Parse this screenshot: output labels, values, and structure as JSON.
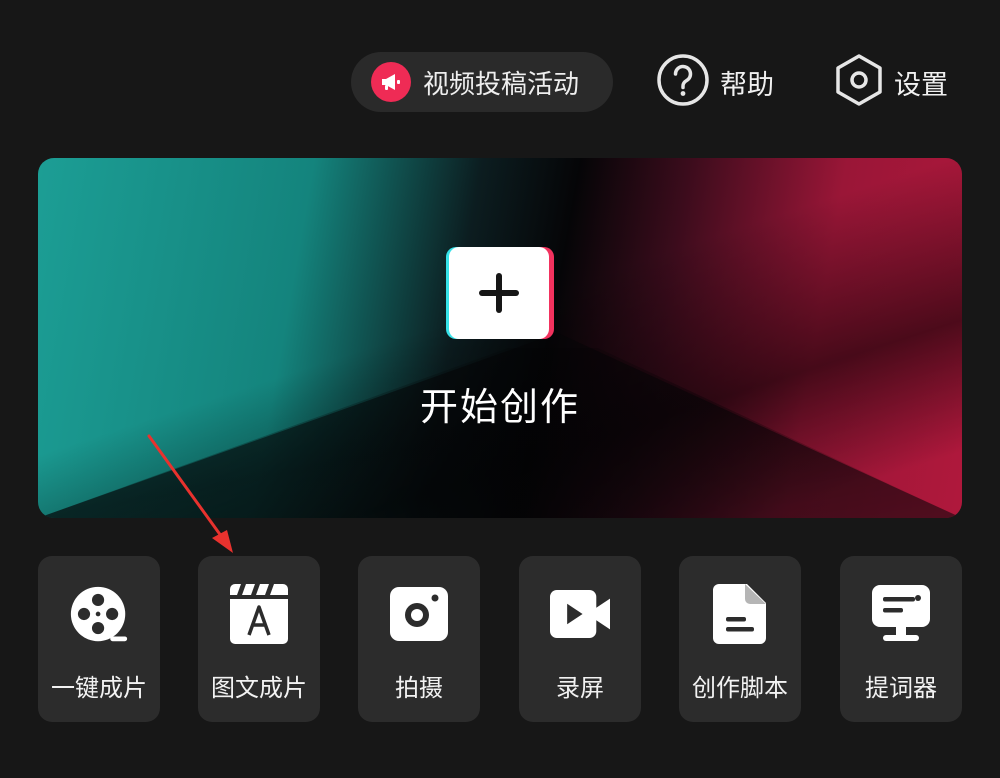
{
  "top_bar": {
    "campaign_label": "视频投稿活动",
    "help_label": "帮助",
    "settings_label": "设置"
  },
  "hero": {
    "title": "开始创作",
    "icon": "plus-icon"
  },
  "tools": [
    {
      "label": "一键成片",
      "icon": "film-reel-icon"
    },
    {
      "label": "图文成片",
      "icon": "text-clapboard-icon"
    },
    {
      "label": "拍摄",
      "icon": "camera-icon"
    },
    {
      "label": "录屏",
      "icon": "video-camera-icon"
    },
    {
      "label": "创作脚本",
      "icon": "script-document-icon"
    },
    {
      "label": "提词器",
      "icon": "teleprompter-icon"
    }
  ],
  "colors": {
    "background": "#171717",
    "card": "#2c2c2c",
    "accent_red": "#ef2b55",
    "accent_cyan": "#36e2e8",
    "annotation_arrow": "#e8322e"
  }
}
